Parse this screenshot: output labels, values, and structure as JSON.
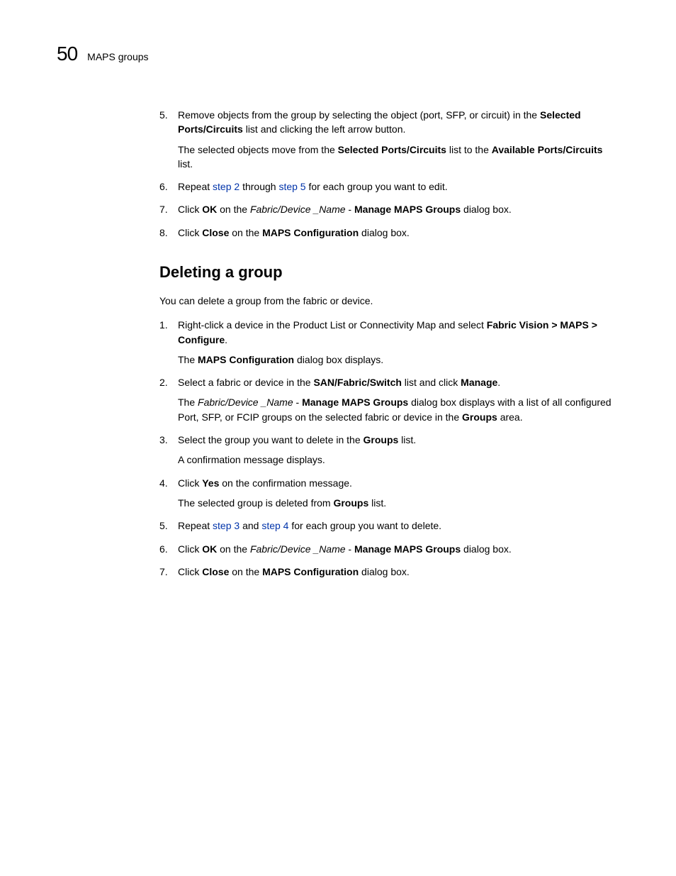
{
  "header": {
    "page_number": "50",
    "section": "MAPS groups"
  },
  "top_steps": {
    "s5": {
      "num": "5.",
      "t1": "Remove objects from the group by selecting the object (port, SFP, or circuit) in the ",
      "b1": "Selected Ports/Circuits",
      "t2": " list and clicking the left arrow button.",
      "sub_t1": "The selected objects move from the ",
      "sub_b1": "Selected Ports/Circuits",
      "sub_t2": " list to the ",
      "sub_b2": "Available Ports/Circuits",
      "sub_t3": " list."
    },
    "s6": {
      "num": "6.",
      "t1": "Repeat ",
      "l1": "step 2",
      "t2": " through ",
      "l2": "step 5",
      "t3": " for each group you want to edit."
    },
    "s7": {
      "num": "7.",
      "t1": "Click ",
      "b1": "OK",
      "t2": " on the ",
      "i1": "Fabric/Device _Name",
      "t3": " - ",
      "b2": "Manage MAPS Groups",
      "t4": " dialog box."
    },
    "s8": {
      "num": "8.",
      "t1": "Click ",
      "b1": "Close",
      "t2": " on the ",
      "b2": "MAPS Configuration",
      "t3": " dialog box."
    }
  },
  "heading": "Deleting a group",
  "intro": "You can delete a group from the fabric or device.",
  "del_steps": {
    "s1": {
      "num": "1.",
      "t1": "Right-click a device in the Product List or Connectivity Map and select ",
      "b1": "Fabric Vision > MAPS > Configure",
      "t2": ".",
      "sub_t1": "The ",
      "sub_b1": "MAPS Configuration",
      "sub_t2": " dialog box displays."
    },
    "s2": {
      "num": "2.",
      "t1": "Select a fabric or device in the ",
      "b1": "SAN/Fabric/Switch",
      "t2": " list and click ",
      "b2": "Manage",
      "t3": ".",
      "sub_t1": "The ",
      "sub_i1": "Fabric/Device _Name",
      "sub_t2": " - ",
      "sub_b1": "Manage MAPS Groups",
      "sub_t3": " dialog box displays with a list of all configured Port, SFP, or FCIP groups on the selected fabric or device in the ",
      "sub_b2": "Groups",
      "sub_t4": " area."
    },
    "s3": {
      "num": "3.",
      "t1": "Select the group you want to delete in the ",
      "b1": "Groups",
      "t2": " list.",
      "sub": "A confirmation message displays."
    },
    "s4": {
      "num": "4.",
      "t1": "Click ",
      "b1": "Yes",
      "t2": " on the confirmation message.",
      "sub_t1": "The selected group is deleted from ",
      "sub_b1": "Groups",
      "sub_t2": " list."
    },
    "s5": {
      "num": "5.",
      "t1": "Repeat ",
      "l1": "step 3",
      "t2": " and ",
      "l2": "step 4",
      "t3": " for each group you want to delete."
    },
    "s6": {
      "num": "6.",
      "t1": "Click ",
      "b1": "OK",
      "t2": " on the ",
      "i1": "Fabric/Device _Name",
      "t3": " - ",
      "b2": "Manage MAPS Groups",
      "t4": " dialog box."
    },
    "s7": {
      "num": "7.",
      "t1": "Click ",
      "b1": "Close",
      "t2": " on the ",
      "b2": "MAPS Configuration",
      "t3": " dialog box."
    }
  }
}
